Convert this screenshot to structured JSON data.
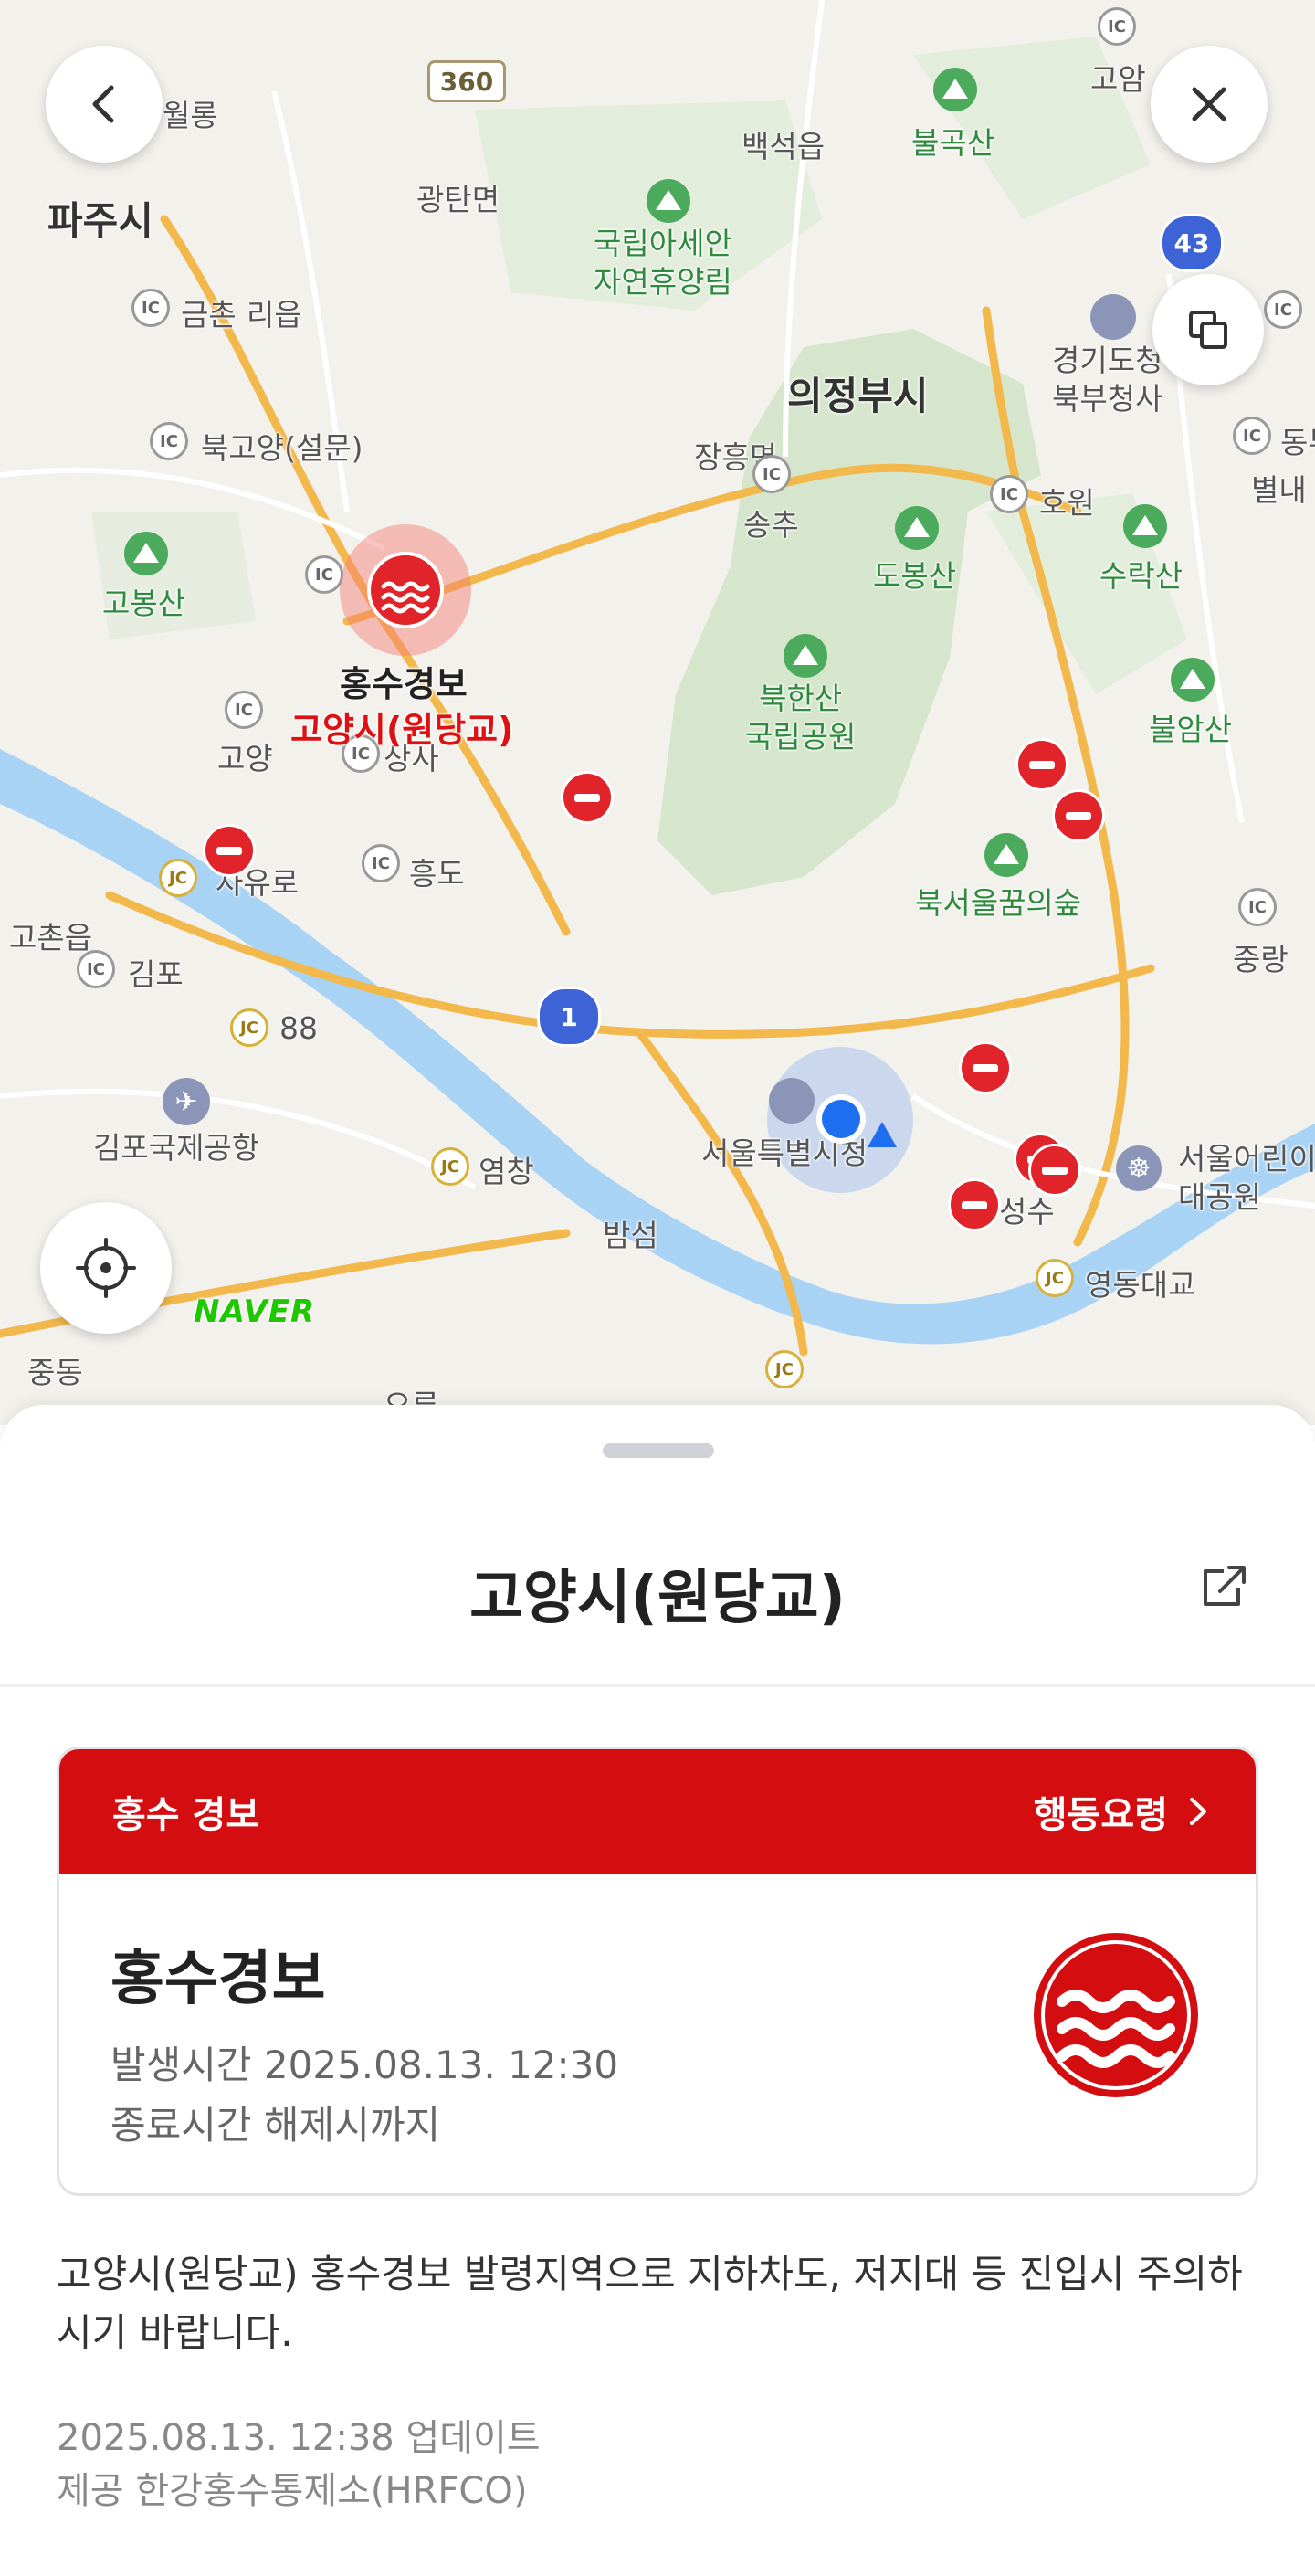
{
  "map": {
    "labels": {
      "paju": "파주시",
      "woryong": "월롱",
      "gwangtan": "광탄면",
      "baekseok": "백석읍",
      "bulgok": "불곡산",
      "goam": "고암",
      "forest": "국립아세안\n자연휴양림",
      "geumchon": "금촌",
      "ri": "리읍",
      "uijeongbu": "의정부시",
      "gyeonggi": "경기도청\n북부청사",
      "bukgoyang": "북고양(설문)",
      "jangheung": "장흥면",
      "songchu": "송추",
      "dobong": "도봉산",
      "howon": "호원",
      "surak": "수락산",
      "goyang_ic": "고양",
      "gobong": "고봉산",
      "bukhan": "북한산\n국립공원",
      "bulam": "불암산",
      "goyang2": "고양",
      "sangsa": "상사",
      "jayuro": "자유로",
      "heungdo": "흥도",
      "goch": "고촌읍",
      "gimpo": "김포",
      "bukseoul": "북서울꿈의숲",
      "jungnang": "중랑",
      "r88": "88",
      "airport": "김포국제공항",
      "yeomchang": "염창",
      "seoul": "서울특별시청",
      "bamseom": "밤섬",
      "seongsu": "성수",
      "children": "서울어린이\n대공원",
      "yeongdong": "영동대교",
      "jungdong": "중동",
      "oryu": "오류",
      "dongbu": "동부",
      "byeolnae": "별내",
      "route360": "360",
      "route43": "43",
      "route1": "1",
      "hongsu_pin": "홍수경보",
      "pin_place": "고양시(원당교)",
      "naver": "NAVER"
    }
  },
  "icons": {
    "back": "chevron-left-icon",
    "close": "close-icon",
    "layers": "layers-icon",
    "locate": "crosshair-icon",
    "share": "share-icon",
    "flood": "flood-warning-icon",
    "no_entry": "road-closed-icon"
  },
  "sheet": {
    "title": "고양시(원당교)",
    "card": {
      "header_label": "홍수 경보",
      "action_label": "행동요령",
      "warning_title": "홍수경보",
      "issued": "발생시간 2025.08.13. 12:30",
      "ends": "종료시간 해제시까지"
    },
    "description": "고양시(원당교) 홍수경보 발령지역으로 지하차도, 저지대 등 진입시 주의하시기 바랍니다.",
    "updated": "2025.08.13. 12:38 업데이트",
    "provider": "제공 한강홍수통제소(HRFCO)"
  },
  "colors": {
    "accent_red": "#d40d10",
    "park_green": "#2f8a3e",
    "river_blue": "#a9d3f5",
    "location_blue": "#1d6ff0"
  }
}
